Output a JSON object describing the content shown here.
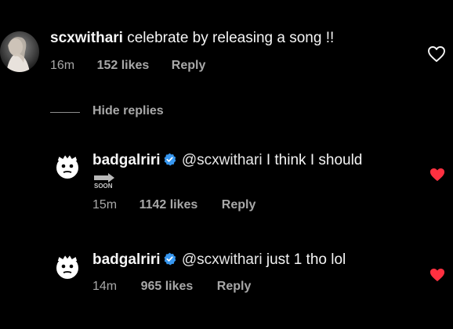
{
  "comment": {
    "username": "scxwithari",
    "text": "celebrate by releasing a song !!",
    "time": "16m",
    "likes": "152 likes",
    "reply": "Reply",
    "liked": false
  },
  "hide_replies": "Hide replies",
  "replies": [
    {
      "username": "badgalriri",
      "verified": true,
      "mention": "@scxwithari",
      "text": "I think I should",
      "sticker_text": "SOON",
      "time": "15m",
      "likes": "1142 likes",
      "reply": "Reply",
      "liked": true
    },
    {
      "username": "badgalriri",
      "verified": true,
      "mention": "@scxwithari",
      "text": "just 1 tho lol",
      "time": "14m",
      "likes": "965 likes",
      "reply": "Reply",
      "liked": true
    }
  ],
  "colors": {
    "background": "#000000",
    "text": "#f5f5f5",
    "muted": "#a8a8a8",
    "heart_liked": "#ff3040",
    "verified": "#3797f0"
  }
}
